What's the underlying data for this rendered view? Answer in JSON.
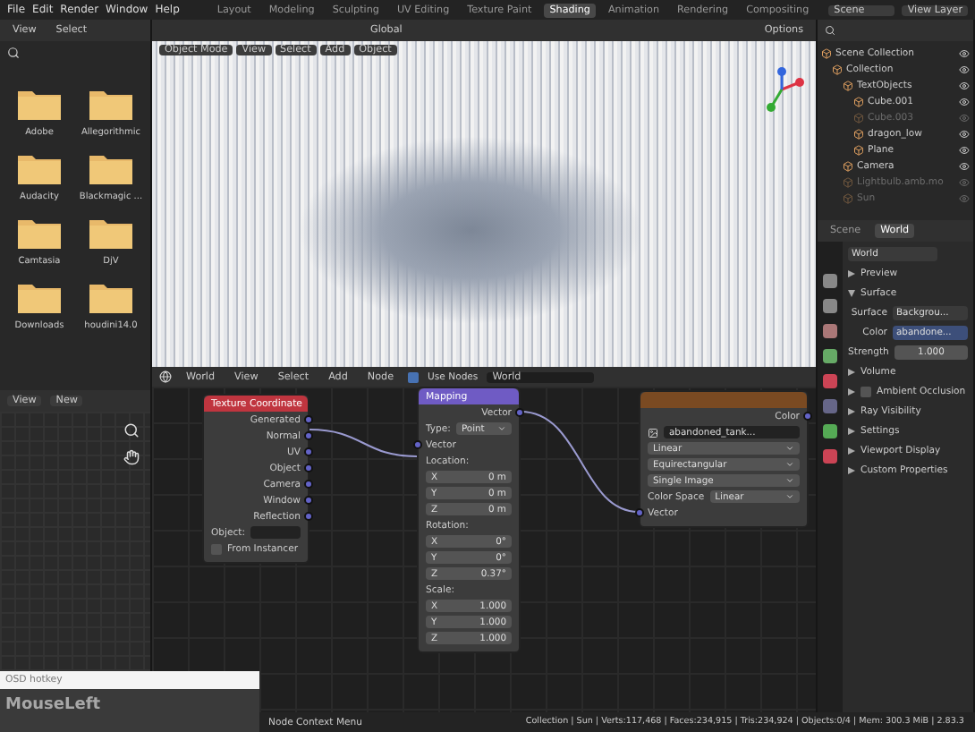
{
  "menu": [
    "File",
    "Edit",
    "Render",
    "Window",
    "Help"
  ],
  "workspaces": [
    {
      "label": "Layout",
      "selected": false
    },
    {
      "label": "Modeling",
      "selected": false
    },
    {
      "label": "Sculpting",
      "selected": false
    },
    {
      "label": "UV Editing",
      "selected": false
    },
    {
      "label": "Texture Paint",
      "selected": false
    },
    {
      "label": "Shading",
      "selected": true
    },
    {
      "label": "Animation",
      "selected": false
    },
    {
      "label": "Rendering",
      "selected": false
    },
    {
      "label": "Compositing",
      "selected": false
    }
  ],
  "scene": "Scene",
  "view_layer": "View Layer",
  "file_browser": {
    "menus": [
      "View",
      "Select"
    ],
    "folders": [
      "Adobe",
      "Allegorithmic",
      "Audacity",
      "Blackmagic ...",
      "Camtasia",
      "DjV",
      "Downloads",
      "houdini14.0"
    ]
  },
  "tool_header": {
    "orientation": "Global",
    "options": "Options"
  },
  "viewport": {
    "menus": [
      "Object Mode",
      "View",
      "Select",
      "Add",
      "Object"
    ]
  },
  "outliner": {
    "items": [
      {
        "label": "Scene Collection",
        "hidden": false,
        "children": [
          {
            "label": "Collection",
            "hidden": false,
            "children": [
              {
                "label": "TextObjects",
                "hidden": false,
                "children": [
                  {
                    "label": "Cube.001",
                    "hidden": false
                  },
                  {
                    "label": "Cube.003",
                    "hidden": true
                  },
                  {
                    "label": "dragon_low",
                    "hidden": false
                  },
                  {
                    "label": "Plane",
                    "hidden": false
                  }
                ]
              },
              {
                "label": "Camera",
                "hidden": false
              },
              {
                "label": "Lightbulb.amb.mo",
                "hidden": true
              },
              {
                "label": "Sun",
                "hidden": true
              }
            ]
          }
        ]
      }
    ]
  },
  "properties": {
    "tabs": [
      {
        "label": "Scene",
        "selected": false
      },
      {
        "label": "World",
        "selected": true
      }
    ],
    "world": "World",
    "panels": [
      {
        "label": "Preview",
        "expanded": false
      },
      {
        "label": "Surface",
        "expanded": true,
        "rows": [
          {
            "kind": "dropdown",
            "label": "Surface",
            "value": "Backgrou..."
          },
          {
            "kind": "link",
            "label": "Color",
            "value": "abandone..."
          },
          {
            "kind": "number",
            "label": "Strength",
            "value": "1.000"
          }
        ]
      },
      {
        "label": "Volume",
        "expanded": false
      },
      {
        "label": "Ambient Occlusion",
        "expanded": false,
        "checked": false
      },
      {
        "label": "Ray Visibility",
        "expanded": false
      },
      {
        "label": "Settings",
        "expanded": false
      },
      {
        "label": "Viewport Display",
        "expanded": false
      },
      {
        "label": "Custom Properties",
        "expanded": false
      }
    ]
  },
  "image_editor": {
    "view": "View",
    "new": "New"
  },
  "node_editor": {
    "world": "World",
    "menus": [
      "View",
      "Select",
      "Add",
      "Node"
    ],
    "use_nodes": {
      "label": "Use Nodes",
      "checked": true
    },
    "world_field": "World"
  },
  "nodes": [
    {
      "title": "Texture Coordinate",
      "color": "#c0353f",
      "rows": [
        {
          "kind": "output",
          "label": "Generated"
        },
        {
          "kind": "output",
          "label": "Normal"
        },
        {
          "kind": "output",
          "label": "UV"
        },
        {
          "kind": "output",
          "label": "Object"
        },
        {
          "kind": "output",
          "label": "Camera"
        },
        {
          "kind": "output",
          "label": "Window"
        },
        {
          "kind": "output",
          "label": "Reflection"
        },
        {
          "kind": "object",
          "label": "Object:"
        },
        {
          "kind": "checkbox",
          "label": "From Instancer",
          "checked": false
        }
      ]
    },
    {
      "title": "Mapping",
      "color": "#6f5bc4",
      "rows": [
        {
          "kind": "output",
          "label": "Vector"
        },
        {
          "kind": "dropdown",
          "label": "Type:",
          "value": "Point"
        },
        {
          "kind": "input",
          "label": "Vector"
        },
        {
          "kind": "label",
          "label": "Location:"
        },
        {
          "kind": "field",
          "label": "X",
          "value": "0 m"
        },
        {
          "kind": "field",
          "label": "Y",
          "value": "0 m"
        },
        {
          "kind": "field",
          "label": "Z",
          "value": "0 m"
        },
        {
          "kind": "label",
          "label": "Rotation:"
        },
        {
          "kind": "field",
          "label": "X",
          "value": "0°"
        },
        {
          "kind": "field",
          "label": "Y",
          "value": "0°"
        },
        {
          "kind": "field",
          "label": "Z",
          "value": "0.37°"
        },
        {
          "kind": "label",
          "label": "Scale:"
        },
        {
          "kind": "field",
          "label": "X",
          "value": "1.000"
        },
        {
          "kind": "field",
          "label": "Y",
          "value": "1.000"
        },
        {
          "kind": "field",
          "label": "Z",
          "value": "1.000"
        }
      ]
    },
    {
      "color": "#7a4a22",
      "rows": [
        {
          "kind": "output",
          "label": "Color"
        },
        {
          "kind": "image",
          "value": "abandoned_tank..."
        },
        {
          "kind": "dropdown",
          "value": "Linear"
        },
        {
          "kind": "dropdown",
          "value": "Equirectangular"
        },
        {
          "kind": "dropdown",
          "value": "Single Image"
        },
        {
          "kind": "dropdown",
          "label": "Color Space",
          "value": "Linear"
        },
        {
          "kind": "input",
          "label": "Vector"
        }
      ]
    }
  ],
  "osd": {
    "title": "OSD hotkey",
    "key": "MouseLeft"
  },
  "status_bar": {
    "hint": "Node Context Menu",
    "stats": "Collection | Sun | Verts:117,468 | Faces:234,915 | Tris:234,924 | Objects:0/4 | Mem: 300.3 MiB | 2.83.3"
  }
}
